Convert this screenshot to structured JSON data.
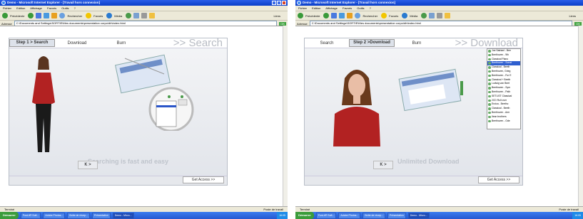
{
  "window_title": "Demo - Microsoft Internet Explorer - [Travail hors connexion]",
  "menu": [
    "Fichier",
    "Edition",
    "Affichage",
    "Favoris",
    "Outils",
    "?"
  ],
  "toolbar": {
    "back": "Précédente",
    "search": "Rechercher",
    "favorites": "Favoris",
    "media": "Média",
    "links": "Liens"
  },
  "address": {
    "label": "Adresse",
    "value": "C:\\Documents and Settings\\SORTIE\\Mes documents\\presentation corpo\\db\\index.html",
    "go": "OK"
  },
  "tabs": [
    "Search",
    "Download",
    "Burn"
  ],
  "left_step": "Step 1",
  "right_step": "Step 2",
  "left_big_word": ">> Search",
  "right_big_word": ">> Download",
  "left_slogan": "Searching is fast and easy",
  "right_slogan": "Unlimited Download",
  "nav_arrows": "K >",
  "access_button": "Get Access >>",
  "status": {
    "left": "Terminé",
    "right": "Poste de travail"
  },
  "taskbar": {
    "start": "Démarrer",
    "tasks": [
      "Post-it® Soft...",
      "Adobe Photos...",
      "Boîte de récep...",
      "Présentation",
      "Demo - Micro..."
    ],
    "clock": "16:05"
  },
  "download_list": [
    "Joe Satriani - Bee",
    "Beethoven - 9th",
    "Classical Piano",
    "Beethoven - Sonat",
    "Classical - Beeth",
    "Beethoven, Grieg",
    "Beethoven - Fur E",
    "Classical + Beeth",
    "Ludwig van Beet",
    "Beethoven - Sym",
    "Beethoven - Path",
    "SETLIST Classical",
    "2CD Roll over",
    "Eroica - Beetho",
    "Classical - Beeth",
    "Beethoven - Arm",
    "Ilean brothers",
    "Beethoven - Ode"
  ]
}
